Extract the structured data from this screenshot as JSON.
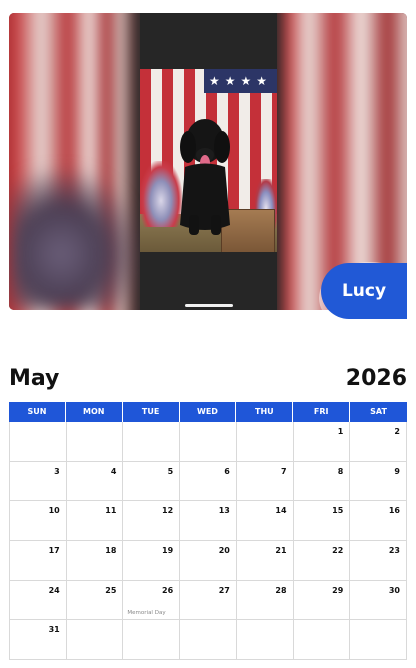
{
  "photo": {
    "name_label": "Lucy",
    "flag_stars": "★★★★"
  },
  "calendar": {
    "month": "May",
    "year": "2026",
    "weekdays": [
      "SUN",
      "MON",
      "TUE",
      "WED",
      "THU",
      "FRI",
      "SAT"
    ],
    "weeks": [
      [
        "",
        "",
        "",
        "",
        "",
        "1",
        "2"
      ],
      [
        "3",
        "4",
        "5",
        "6",
        "7",
        "8",
        "9"
      ],
      [
        "10",
        "11",
        "12",
        "13",
        "14",
        "15",
        "16"
      ],
      [
        "17",
        "18",
        "19",
        "20",
        "21",
        "22",
        "23"
      ],
      [
        "24",
        "25",
        "26",
        "27",
        "28",
        "29",
        "30"
      ],
      [
        "31",
        "",
        "",
        "",
        "",
        "",
        ""
      ]
    ],
    "holiday_note": "Memorial Day"
  },
  "colors": {
    "accent": "#1f56d8",
    "badge": "#2159d6"
  }
}
